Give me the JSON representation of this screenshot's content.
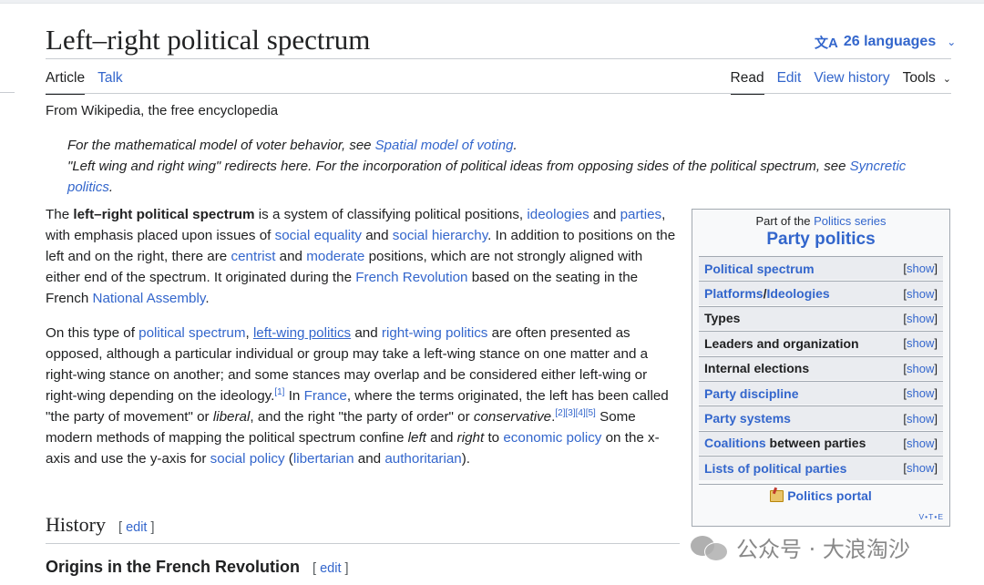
{
  "page": {
    "title": "Left–right political spectrum",
    "languages": "26 languages",
    "tagline": "From Wikipedia, the free encyclopedia"
  },
  "tabs": {
    "article": "Article",
    "talk": "Talk",
    "read": "Read",
    "edit": "Edit",
    "view_history": "View history",
    "tools": "Tools"
  },
  "hatnote": {
    "line1_prefix": "For the mathematical model of voter behavior, see ",
    "line1_link": "Spatial model of voting",
    "line1_suffix": ".",
    "line2_prefix": "\"Left wing and right wing\" redirects here. For the incorporation of political ideas from opposing sides of the political spectrum, see ",
    "line2_link": "Syncretic politics",
    "line2_suffix": "."
  },
  "para1": {
    "t1": "The ",
    "bold": "left–right political spectrum",
    "t2": " is a system of classifying political positions, ",
    "l_ideologies": "ideologies",
    "t3": " and ",
    "l_parties": "parties",
    "t4": ", with emphasis placed upon issues of ",
    "l_social_equality": "social equality",
    "t5": " and ",
    "l_social_hierarchy": "social hierarchy",
    "t6": ". In addition to positions on the left and on the right, there are ",
    "l_centrist": "centrist",
    "t7": " and ",
    "l_moderate": "moderate",
    "t8": " positions, which are not strongly aligned with either end of the spectrum. It originated during the ",
    "l_french_revolution": "French Revolution",
    "t9": " based on the seating in the French ",
    "l_national_assembly": "National Assembly",
    "t10": "."
  },
  "para2": {
    "t1": "On this type of ",
    "l_political_spectrum": "political spectrum",
    "t2": ", ",
    "l_left_wing": "left-wing politics",
    "t3": " and ",
    "l_right_wing": "right-wing politics",
    "t4": " are often presented as opposed, although a particular individual or group may take a left-wing stance on one matter and a right-wing stance on another; and some stances may overlap and be considered either left-wing or right-wing depending on the ideology.",
    "ref1": "[1]",
    "t5": " In ",
    "l_france": "France",
    "t6": ", where the terms originated, the left has been called \"the party of movement\" or ",
    "i_liberal": "liberal",
    "t7": ", and the right \"the party of order\" or ",
    "i_conservative": "conservative",
    "t8": ".",
    "refs2": "[2][3][4][5]",
    "t9": " Some modern methods of mapping the political spectrum confine ",
    "i_left": "left",
    "t10": " and ",
    "i_right": "right",
    "t11": " to ",
    "l_economic_policy": "economic policy",
    "t12": " on the x-axis and use the y-axis for ",
    "l_social_policy": "social policy",
    "t13": " (",
    "l_libertarian": "libertarian",
    "t14": " and ",
    "l_authoritarian": "authoritarian",
    "t15": ")."
  },
  "sections": {
    "history": "History",
    "origins": "Origins in the French Revolution",
    "edit_open": "[ ",
    "edit_label": "edit",
    "edit_close": " ]"
  },
  "sidebar": {
    "pretitle_prefix": "Part of the ",
    "pretitle_link": "Politics series",
    "title": "Party politics",
    "show_open": "[",
    "show_label": "show",
    "show_close": "]",
    "rows": [
      {
        "label": "Political spectrum"
      },
      {
        "a": "Platforms",
        "sep": "/",
        "b": "Ideologies"
      },
      {
        "label": "Types"
      },
      {
        "label": "Leaders and organization"
      },
      {
        "label": "Internal elections"
      },
      {
        "label": "Party discipline"
      },
      {
        "label": "Party systems"
      },
      {
        "a": "Coalitions",
        "b": " between parties"
      },
      {
        "label": "Lists of political parties"
      }
    ],
    "portal": "Politics portal",
    "vte_v": "V",
    "vte_t": "T",
    "vte_e": "E",
    "vte_dot": "•"
  },
  "watermark": {
    "text": "公众号 · 大浪淘沙"
  }
}
